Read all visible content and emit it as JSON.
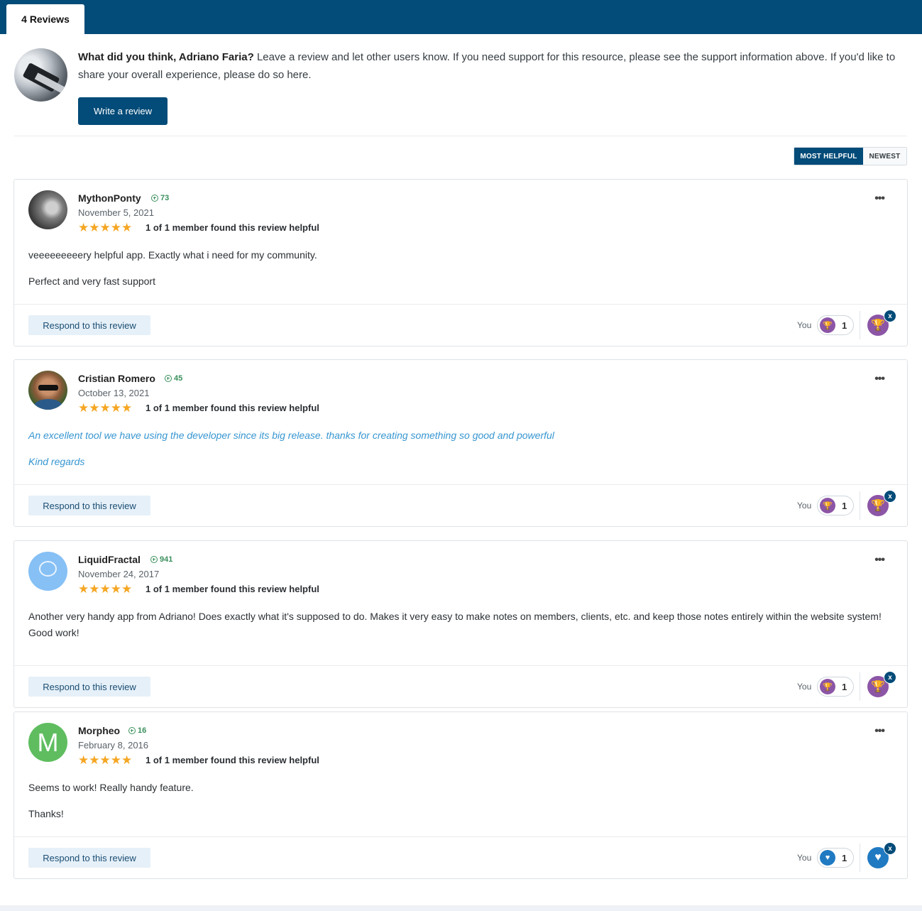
{
  "tab": {
    "label": "4 Reviews"
  },
  "prompt": {
    "question": "What did you think, Adriano Faria?",
    "text": " Leave a review and let other users know. If you need support for this resource, please see the support information above. If you'd like to share your overall experience, please do so here.",
    "button": "Write a review"
  },
  "sort": {
    "most_helpful": "MOST HELPFUL",
    "newest": "NEWEST"
  },
  "reviews": [
    {
      "author": "MythonPonty",
      "reputation": "73",
      "date": "November 5, 2021",
      "rating": 5,
      "stars": "★★★★★",
      "helpful": "1 of 1 member found this review helpful",
      "paragraphs": [
        "veeeeeeeeery helpful app. Exactly what i need for my community.",
        "Perfect and very fast support"
      ],
      "respond": "Respond to this review",
      "you": "You",
      "reaction_count": "1",
      "reaction": "trophy-icon"
    },
    {
      "author": "Cristian Romero",
      "reputation": "45",
      "date": "October 13, 2021",
      "rating": 5,
      "stars": "★★★★★",
      "helpful": "1 of 1 member found this review helpful",
      "paragraphs": [
        "An excellent tool we have using the developer since its big release. thanks for creating something so good and powerful",
        "Kind regards"
      ],
      "respond": "Respond to this review",
      "you": "You",
      "reaction_count": "1",
      "reaction": "trophy-icon"
    },
    {
      "author": "LiquidFractal",
      "reputation": "941",
      "date": "November 24, 2017",
      "rating": 5,
      "stars": "★★★★★",
      "helpful": "1 of 1 member found this review helpful",
      "paragraphs": [
        "Another very handy app from Adriano!  Does exactly what it's supposed to do.  Makes it very easy to make notes on members, clients, etc. and keep those notes entirely within the website system!  Good work!"
      ],
      "respond": "Respond to this review",
      "you": "You",
      "reaction_count": "1",
      "reaction": "trophy-icon"
    },
    {
      "author": "Morpheo",
      "avatar_letter": "M",
      "reputation": "16",
      "date": "February 8, 2016",
      "rating": 5,
      "stars": "★★★★★",
      "helpful": "1 of 1 member found this review helpful",
      "paragraphs": [
        "Seems to work! Really handy feature.",
        "Thanks!"
      ],
      "respond": "Respond to this review",
      "you": "You",
      "reaction_count": "1",
      "reaction": "heart-icon"
    }
  ],
  "more_glyph": "•••",
  "close_glyph": "x",
  "colors": {
    "brand": "#034b78",
    "star": "#f5a623",
    "trophy": "#8c55a6",
    "heart": "#1f7ac2",
    "rep": "#3a8f5c",
    "quote": "#3796d1"
  }
}
